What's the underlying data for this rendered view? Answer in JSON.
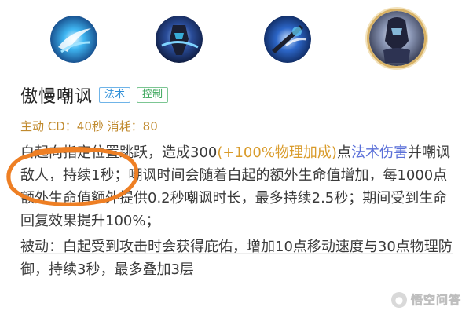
{
  "skill": {
    "name": "傲慢嘲讽",
    "tags": {
      "magic": "法术",
      "control": "控制"
    },
    "meta": "主动 CD：40秒 消耗：80"
  },
  "description": {
    "active": {
      "p1": "向指定位置跳跃，造成300",
      "p1_gold": "(+100%物理加成)",
      "p1_mid": "点",
      "p1_blue": "法术伤害",
      "p2": "并嘲讽敌人，持续1秒；嘲讽时间会随着白起的额外生命值增加，每1000点额外生命值额外提供0.2秒嘲讽时长，最多持续2.5秒；期间受到生命回复效果提升100%；",
      "p2_prefix": "白起"
    },
    "passive": "被动：白起受到攻击时会获得庇佑，增加10点移动速度与30点物理防御，持续3秒，最多叠加3层"
  },
  "watermark": {
    "text": "悟空问答"
  },
  "colors": {
    "tag_magic": "#2f8fd8",
    "tag_control": "#3aa65a",
    "meta_text": "#c08a2e",
    "highlight_gold": "#d99b2b",
    "highlight_blue": "#5a6fd8",
    "annotation_circle": "#ee7f24",
    "selected_ring": "#d8b266"
  },
  "icons": [
    "skill-1-icon",
    "skill-2-icon",
    "skill-3-icon",
    "skill-4-icon-selected"
  ]
}
